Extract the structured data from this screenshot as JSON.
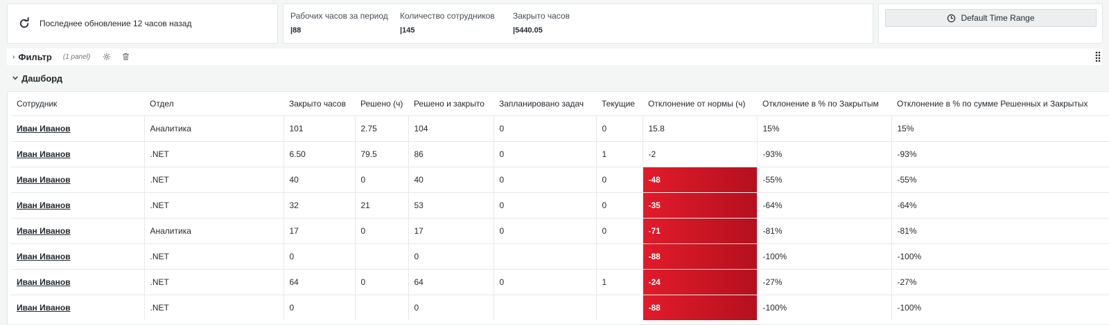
{
  "refresh": {
    "text": "Последнее обновление 12 часов назад",
    "icon": "refresh-icon"
  },
  "stats": [
    {
      "title": "Рабочих часов за период",
      "value": "88"
    },
    {
      "title": "Количество сотрудников",
      "value": "145"
    },
    {
      "title": "Закрыто часов",
      "value": "5440.05"
    }
  ],
  "time_range": {
    "label": "Default Time Range",
    "icon": "clock-icon"
  },
  "filter_row": {
    "title": "Фильтр",
    "panel_count": "(1 panel)",
    "icons": [
      "gear-icon",
      "trash-icon",
      "drag-handle-icon"
    ]
  },
  "dashboard_row": {
    "title": "Дашборд"
  },
  "table": {
    "columns": [
      "Сотрудник",
      "Отдел",
      "Закрыто часов",
      "Решено (ч)",
      "Решено и закрыто",
      "Запланировано задач",
      "Текущие",
      "Отклонение от нормы (ч)",
      "Отклонение в % по Закрытым",
      "Отклонение в % по сумме Решенных и Закрытых"
    ],
    "rows": [
      [
        "Иван Иванов",
        "Аналитика",
        "101",
        "2.75",
        "104",
        "0",
        "0",
        "15.8",
        "15%",
        "15%"
      ],
      [
        "Иван Иванов",
        ".NET",
        "6.50",
        "79.5",
        "86",
        "0",
        "1",
        "-2",
        "-93%",
        "-93%"
      ],
      [
        "Иван Иванов",
        ".NET",
        "40",
        "0",
        "40",
        "0",
        "0",
        "-48",
        "-55%",
        "-55%"
      ],
      [
        "Иван Иванов",
        ".NET",
        "32",
        "21",
        "53",
        "0",
        "0",
        "-35",
        "-64%",
        "-64%"
      ],
      [
        "Иван Иванов",
        "Аналитика",
        "17",
        "0",
        "17",
        "0",
        "0",
        "-71",
        "-81%",
        "-81%"
      ],
      [
        "Иван Иванов",
        ".NET",
        "0",
        "",
        "0",
        "",
        "",
        "-88",
        "-100%",
        "-100%"
      ],
      [
        "Иван Иванов",
        ".NET",
        "64",
        "0",
        "64",
        "0",
        "1",
        "-24",
        "-27%",
        "-27%"
      ],
      [
        "Иван Иванов",
        ".NET",
        "0",
        "",
        "0",
        "",
        "",
        "-88",
        "-100%",
        "-100%"
      ]
    ],
    "highlight_column": 7,
    "highlight_rows": [
      2,
      3,
      4,
      5,
      6,
      7
    ],
    "highlight_color_start": "#e21b2a",
    "highlight_color_end": "#b5101f"
  }
}
